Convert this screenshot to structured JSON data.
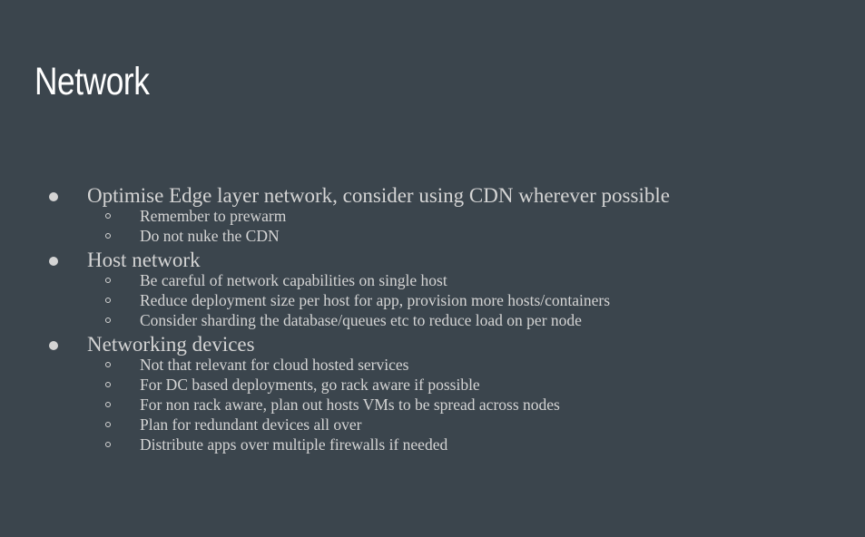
{
  "slide": {
    "title": "Network"
  },
  "bullets": [
    {
      "text": "Optimise Edge layer network, consider using CDN wherever possible",
      "sub": [
        "Remember to prewarm",
        "Do not nuke the CDN"
      ]
    },
    {
      "text": "Host network",
      "sub": [
        "Be careful of network capabilities on single host",
        "Reduce deployment size per host for app, provision more hosts/containers",
        "Consider sharding the database/queues etc to reduce load on per node"
      ]
    },
    {
      "text": "Networking devices",
      "sub": [
        "Not that relevant for cloud hosted services",
        "For DC based deployments, go rack aware if possible",
        "For non rack aware, plan out hosts VMs to be spread across nodes",
        "Plan for redundant devices all over",
        "Distribute apps over multiple firewalls if needed"
      ]
    }
  ],
  "colors": {
    "background": "#3b454d",
    "title": "#ffffff",
    "body_text": "#d4d4d4"
  }
}
